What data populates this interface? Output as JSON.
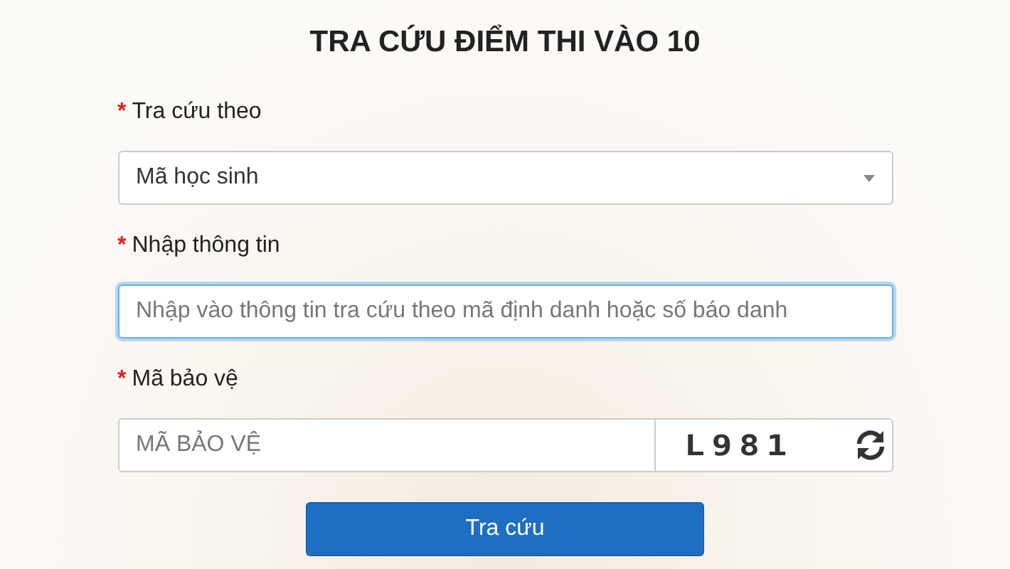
{
  "title": "TRA CỨU ĐIỂM THI VÀO 10",
  "fields": [
    {
      "kind": "select",
      "marker": "*",
      "label": "Tra cứu theo",
      "value": "Mã học sinh",
      "focused": false
    },
    {
      "kind": "text",
      "marker": "*",
      "label": "Nhập thông tin",
      "placeholder": "Nhập vào thông tin tra cứu theo mã định danh hoặc số báo danh",
      "focused": true
    },
    {
      "kind": "captcha",
      "marker": "*",
      "label": "Mã bảo vệ",
      "placeholder": "MÃ BẢO VỆ",
      "code": "L981",
      "focused": false
    }
  ],
  "submit": {
    "label": "Tra cứu"
  }
}
